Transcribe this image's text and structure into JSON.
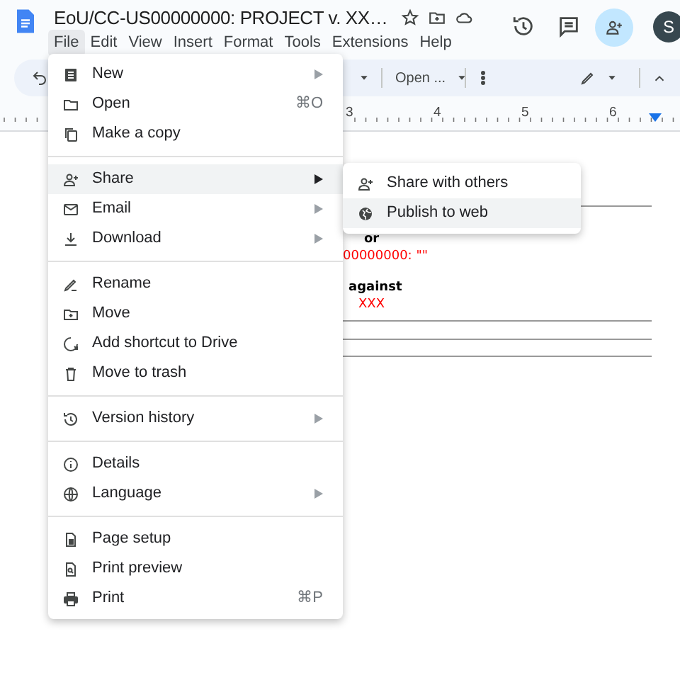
{
  "document_title": "EoU/CC-US00000000: PROJECT v. XX…",
  "menu_bar": [
    {
      "label": "File",
      "selected": true
    },
    {
      "label": "Edit",
      "selected": false
    },
    {
      "label": "View",
      "selected": false
    },
    {
      "label": "Insert",
      "selected": false
    },
    {
      "label": "Format",
      "selected": false
    },
    {
      "label": "Tools",
      "selected": false
    },
    {
      "label": "Extensions",
      "selected": false
    },
    {
      "label": "Help",
      "selected": false
    }
  ],
  "account": {
    "initial": "S"
  },
  "toolbar": {
    "font_menu": "Open ..."
  },
  "ruler": {
    "numbers": [
      "3",
      "4",
      "5",
      "6"
    ]
  },
  "document": {
    "lines": [
      {
        "text": "or",
        "color": "#000000",
        "bold": true
      },
      {
        "text": "00000000: \"\"",
        "color": "#ff0000",
        "bold": false
      },
      {
        "text": "against",
        "color": "#000000",
        "bold": true
      },
      {
        "text": "XXX",
        "color": "#ff0000",
        "bold": false
      }
    ]
  },
  "file_menu": {
    "groups": [
      {
        "items": [
          {
            "label": "New",
            "has_submenu": true,
            "selected": false
          },
          {
            "label": "Open",
            "shortcut": "⌘O",
            "has_submenu": false,
            "selected": false
          },
          {
            "label": "Make a copy",
            "has_submenu": false,
            "selected": false
          }
        ]
      },
      {
        "items": [
          {
            "label": "Share",
            "has_submenu": true,
            "selected": true
          },
          {
            "label": "Email",
            "has_submenu": true,
            "selected": false
          },
          {
            "label": "Download",
            "has_submenu": true,
            "selected": false
          }
        ]
      },
      {
        "items": [
          {
            "label": "Rename",
            "has_submenu": false,
            "selected": false
          },
          {
            "label": "Move",
            "has_submenu": false,
            "selected": false
          },
          {
            "label": "Add shortcut to Drive",
            "has_submenu": false,
            "selected": false
          },
          {
            "label": "Move to trash",
            "has_submenu": false,
            "selected": false
          }
        ]
      },
      {
        "items": [
          {
            "label": "Version history",
            "has_submenu": true,
            "selected": false
          }
        ]
      },
      {
        "items": [
          {
            "label": "Details",
            "has_submenu": false,
            "selected": false
          },
          {
            "label": "Language",
            "has_submenu": true,
            "selected": false
          }
        ]
      },
      {
        "items": [
          {
            "label": "Page setup",
            "has_submenu": false,
            "selected": false
          },
          {
            "label": "Print preview",
            "has_submenu": false,
            "selected": false
          },
          {
            "label": "Print",
            "shortcut": "⌘P",
            "has_submenu": false,
            "selected": false
          }
        ]
      }
    ]
  },
  "share_submenu": {
    "items": [
      {
        "label": "Share with others",
        "selected": false
      },
      {
        "label": "Publish to web",
        "selected": true
      }
    ]
  }
}
